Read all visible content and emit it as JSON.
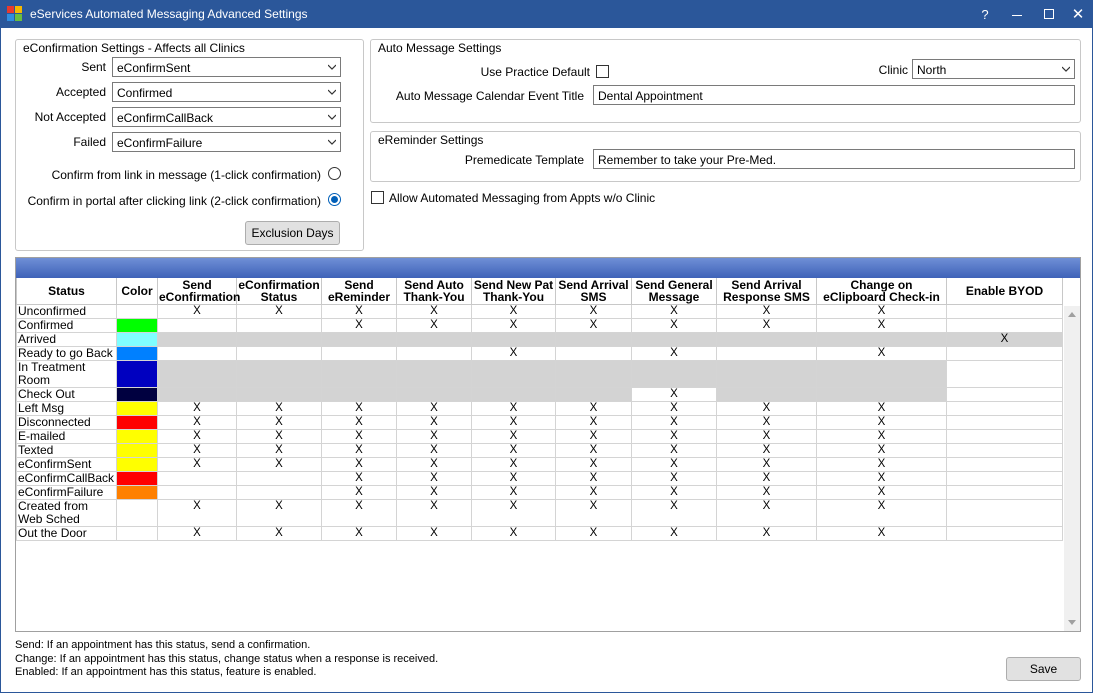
{
  "window": {
    "title": "eServices Automated Messaging Advanced Settings",
    "help_label": "?",
    "close_label": "✕"
  },
  "econfirm": {
    "title": "eConfirmation Settings - Affects all Clinics",
    "sent_label": "Sent",
    "sent_value": "eConfirmSent",
    "accepted_label": "Accepted",
    "accepted_value": "Confirmed",
    "not_accepted_label": "Not Accepted",
    "not_accepted_value": "eConfirmCallBack",
    "failed_label": "Failed",
    "failed_value": "eConfirmFailure",
    "one_click_label": "Confirm from link in message (1-click confirmation)",
    "two_click_label": "Confirm in portal after clicking link (2-click confirmation)",
    "exclusion_label": "Exclusion Days"
  },
  "auto_message": {
    "title": "Auto Message Settings",
    "use_default_label": "Use Practice Default",
    "clinic_label": "Clinic",
    "clinic_value": "North",
    "event_title_label": "Auto Message Calendar Event Title",
    "event_title_value": "Dental Appointment"
  },
  "ereminder": {
    "title": "eReminder Settings",
    "template_label": "Premedicate Template",
    "template_value": "Remember to take your Pre-Med."
  },
  "allow_label": "Allow Automated Messaging from Appts w/o Clinic",
  "grid": {
    "headers": [
      "Status",
      "Color",
      "Send eConfirmation",
      "eConfirmation Status",
      "Send eReminder",
      "Send Auto Thank-You",
      "Send New Pat Thank-You",
      "Send Arrival SMS",
      "Send General Message",
      "Send Arrival Response SMS",
      "Change on eClipboard Check-in",
      "Enable BYOD"
    ],
    "rows": [
      {
        "status": "Unconfirmed",
        "color": "#ffffff",
        "cells": [
          "X",
          "X",
          "X",
          "X",
          "X",
          "X",
          "X",
          "X",
          "X",
          ""
        ],
        "gray": [
          0,
          0,
          0,
          0,
          0,
          0,
          0,
          0,
          0,
          0
        ]
      },
      {
        "status": "Confirmed",
        "color": "#00ff00",
        "cells": [
          "",
          "",
          "X",
          "X",
          "X",
          "X",
          "X",
          "X",
          "X",
          ""
        ],
        "gray": [
          0,
          0,
          0,
          0,
          0,
          0,
          0,
          0,
          0,
          0
        ]
      },
      {
        "status": "Arrived",
        "color": "#80ffff",
        "cells": [
          "",
          "",
          "",
          "",
          "",
          "",
          "",
          "",
          "",
          "X"
        ],
        "gray": [
          1,
          1,
          1,
          1,
          1,
          1,
          1,
          1,
          1,
          1
        ]
      },
      {
        "status": "Ready to go Back",
        "color": "#0080ff",
        "cells": [
          "",
          "",
          "",
          "",
          "X",
          "",
          "X",
          "",
          "X",
          ""
        ],
        "gray": [
          0,
          0,
          0,
          0,
          0,
          0,
          0,
          0,
          0,
          0
        ]
      },
      {
        "status": "In Treatment Room",
        "color": "#0000c0",
        "cells": [
          "",
          "",
          "",
          "",
          "",
          "",
          "",
          "",
          "",
          ""
        ],
        "gray": [
          1,
          1,
          1,
          1,
          1,
          1,
          1,
          1,
          1,
          0
        ]
      },
      {
        "status": "Check Out",
        "color": "#000040",
        "cells": [
          "",
          "",
          "",
          "",
          "",
          "",
          "X",
          "",
          "",
          ""
        ],
        "gray": [
          1,
          1,
          1,
          1,
          1,
          1,
          0,
          1,
          1,
          0
        ]
      },
      {
        "status": "Left Msg",
        "color": "#ffff00",
        "cells": [
          "X",
          "X",
          "X",
          "X",
          "X",
          "X",
          "X",
          "X",
          "X",
          ""
        ],
        "gray": [
          0,
          0,
          0,
          0,
          0,
          0,
          0,
          0,
          0,
          0
        ]
      },
      {
        "status": "Disconnected",
        "color": "#ff0000",
        "cells": [
          "X",
          "X",
          "X",
          "X",
          "X",
          "X",
          "X",
          "X",
          "X",
          ""
        ],
        "gray": [
          0,
          0,
          0,
          0,
          0,
          0,
          0,
          0,
          0,
          0
        ]
      },
      {
        "status": "E-mailed",
        "color": "#ffff00",
        "cells": [
          "X",
          "X",
          "X",
          "X",
          "X",
          "X",
          "X",
          "X",
          "X",
          ""
        ],
        "gray": [
          0,
          0,
          0,
          0,
          0,
          0,
          0,
          0,
          0,
          0
        ]
      },
      {
        "status": "Texted",
        "color": "#ffff00",
        "cells": [
          "X",
          "X",
          "X",
          "X",
          "X",
          "X",
          "X",
          "X",
          "X",
          ""
        ],
        "gray": [
          0,
          0,
          0,
          0,
          0,
          0,
          0,
          0,
          0,
          0
        ]
      },
      {
        "status": "eConfirmSent",
        "color": "#ffff00",
        "cells": [
          "X",
          "X",
          "X",
          "X",
          "X",
          "X",
          "X",
          "X",
          "X",
          ""
        ],
        "gray": [
          0,
          0,
          0,
          0,
          0,
          0,
          0,
          0,
          0,
          0
        ]
      },
      {
        "status": "eConfirmCallBack",
        "color": "#ff0000",
        "cells": [
          "",
          "",
          "X",
          "X",
          "X",
          "X",
          "X",
          "X",
          "X",
          ""
        ],
        "gray": [
          0,
          0,
          0,
          0,
          0,
          0,
          0,
          0,
          0,
          0
        ]
      },
      {
        "status": "eConfirmFailure",
        "color": "#ff8000",
        "cells": [
          "",
          "",
          "X",
          "X",
          "X",
          "X",
          "X",
          "X",
          "X",
          ""
        ],
        "gray": [
          0,
          0,
          0,
          0,
          0,
          0,
          0,
          0,
          0,
          0
        ]
      },
      {
        "status": "Created from Web Sched",
        "color": "#ffffff",
        "cells": [
          "X",
          "X",
          "X",
          "X",
          "X",
          "X",
          "X",
          "X",
          "X",
          ""
        ],
        "gray": [
          0,
          0,
          0,
          0,
          0,
          0,
          0,
          0,
          0,
          0
        ]
      },
      {
        "status": "Out the Door",
        "color": "#ffffff",
        "cells": [
          "X",
          "X",
          "X",
          "X",
          "X",
          "X",
          "X",
          "X",
          "X",
          ""
        ],
        "gray": [
          0,
          0,
          0,
          0,
          0,
          0,
          0,
          0,
          0,
          0
        ]
      }
    ]
  },
  "legend": {
    "send": "Send: If an appointment has this status, send a confirmation.",
    "change": "Change: If an appointment has this status, change status when a response is received.",
    "enabled": "Enabled: If an appointment has this status, feature is enabled."
  },
  "save_label": "Save"
}
